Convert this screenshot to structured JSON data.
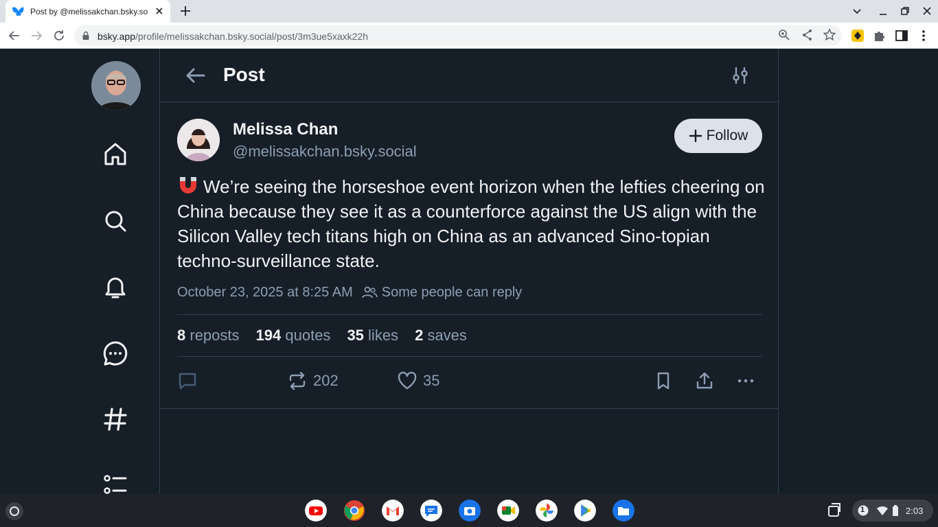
{
  "browser": {
    "tab_title": "Post by @melissakchan.bsky.so",
    "url_host": "bsky.app",
    "url_path": "/profile/melissakchan.bsky.social/post/3m3ue5xaxk22h"
  },
  "header": {
    "title": "Post"
  },
  "post": {
    "author_name": "Melissa Chan",
    "author_handle": "@melissakchan.bsky.social",
    "follow_label": "Follow",
    "text": "We’re seeing the horseshoe event horizon when the lefties cheering on China because they see it as a counterforce against the US align with the Silicon Valley tech titans high on China as an advanced Sino-topian techno-surveillance state.",
    "timestamp": "October 23, 2025 at 8:25 AM",
    "reply_setting": "Some people can reply",
    "stats": {
      "reposts_count": "8",
      "reposts_label": "reposts",
      "quotes_count": "194",
      "quotes_label": "quotes",
      "likes_count": "35",
      "likes_label": "likes",
      "saves_count": "2",
      "saves_label": "saves"
    },
    "actions": {
      "repost_count": "202",
      "like_count": "35"
    }
  },
  "shelf": {
    "time": "2:03",
    "notification_count": "1"
  },
  "colors": {
    "background": "#161e27",
    "border": "#2e4052",
    "muted_text": "#8d9eb4",
    "brand": "#1185fe"
  }
}
